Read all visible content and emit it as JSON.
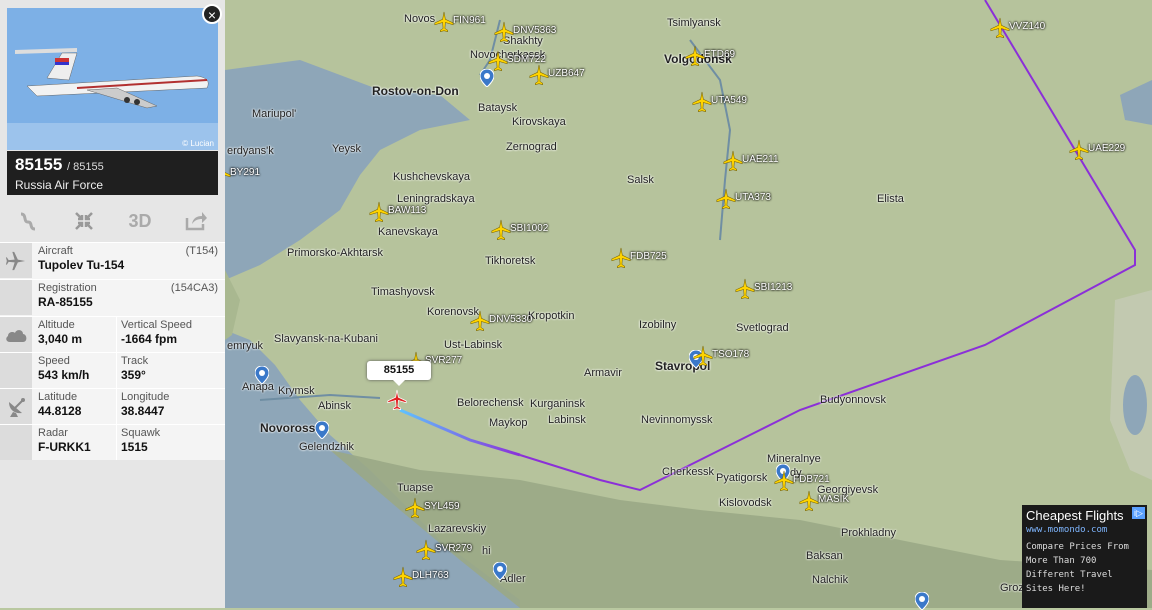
{
  "flight": {
    "callsign_tag": "85155",
    "number": "85155",
    "number_small": "/ 85155",
    "operator": "Russia Air Force",
    "photo_credit": "© Lucian"
  },
  "toolbar": {
    "route_icon": "route-icon",
    "center_icon": "center-icon",
    "view3d_label": "3D",
    "share_icon": "share-icon"
  },
  "details": {
    "aircraft_label": "Aircraft",
    "aircraft_code": "(T154)",
    "aircraft_value": "Tupolev Tu-154",
    "registration_label": "Registration",
    "registration_code": "(154CA3)",
    "registration_value": "RA-85155",
    "altitude_label": "Altitude",
    "altitude_value": "3,040 m",
    "vspeed_label": "Vertical Speed",
    "vspeed_value": "-1664 fpm",
    "speed_label": "Speed",
    "speed_value": "543 km/h",
    "track_label": "Track",
    "track_value": "359°",
    "latitude_label": "Latitude",
    "latitude_value": "44.8128",
    "longitude_label": "Longitude",
    "longitude_value": "38.8447",
    "radar_label": "Radar",
    "radar_value": "F-URKK1",
    "squawk_label": "Squawk",
    "squawk_value": "1515"
  },
  "cities": [
    "Novos",
    "Shakhty",
    "Tsimlyansk",
    "Novocherkassk",
    "Volgodonsk",
    "Rostov-on-Don",
    "Mariupol'",
    "Bataysk",
    "Kirovskaya",
    "Zernograd",
    "Yeysk",
    "erdyans'k",
    "Kushchevskaya",
    "Salsk",
    "Elista",
    "Leningradskaya",
    "Kanevskaya",
    "Primorsko-Akhtarsk",
    "Tikhoretsk",
    "Timashyovsk",
    "Korenovsk",
    "Kropotkin",
    "Izobilny",
    "Svetlograd",
    "Slavyansk-na-Kubani",
    "emryuk",
    "Ust-Labinsk",
    "Armavir",
    "Stavropol",
    "Anapa",
    "Krymsk",
    "Abinsk",
    "Novoross",
    "Belorechensk",
    "Kurganinsk",
    "Budyonnovsk",
    "Gelendzhik",
    "Maykop",
    "Labinsk",
    "Nevinnomyssk",
    "Mineralnye",
    "dy",
    "Cherkessk",
    "Pyatigorsk",
    "Georgiyevsk",
    "Tuapse",
    "Kislovodsk",
    "Lazarevskiy",
    "Prokhladny",
    "hi",
    "Baksan",
    "Adler",
    "Nalchik",
    "Grozn"
  ],
  "flights": [
    "FIN961",
    "DNV5363",
    "SDM722",
    "UZB647",
    "ETD69",
    "UTA549",
    "UAE211",
    "UTA373",
    "UAE229",
    "VVZ140",
    "BY291",
    "BAW113",
    "SBI1002",
    "FDB725",
    "SBI1213",
    "DNV5330",
    "TSO178",
    "SVR277",
    "FDB721",
    "MASIK",
    "SYL459",
    "SVR279",
    "DLH763"
  ],
  "ad": {
    "title": "Cheapest Flights",
    "url": "www.momondo.com",
    "body": "Compare Prices From More Than 700 Different Travel Sites Here!",
    "badge": "i▷"
  },
  "colors": {
    "sea": "#8ea6b8",
    "land": "#b9c8a0",
    "mountains": "#9aa886",
    "route": "#8b2fd8",
    "trail_start": "#5fc3ff",
    "plane": "#ffd400",
    "selected_plane": "#e02020"
  },
  "close_label": "×"
}
